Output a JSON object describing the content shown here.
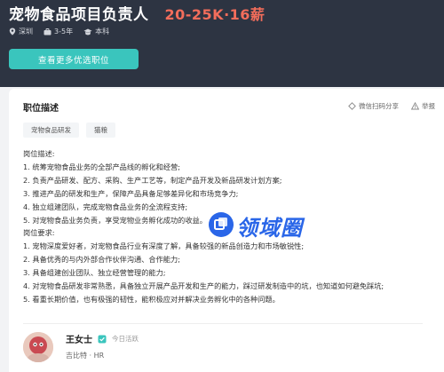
{
  "header": {
    "job_title": "宠物食品项目负责人",
    "salary": "20-25K·16薪",
    "meta": {
      "location": "深圳",
      "experience": "3-5年",
      "education": "本科"
    },
    "more_button": "查看更多优选职位"
  },
  "card": {
    "section_title": "职位描述",
    "wechat_share": "微信扫码分享",
    "report": "举报",
    "tags": [
      "宠物食品研发",
      "猫粮"
    ],
    "description_lines": [
      "岗位描述:",
      "1. 统筹宠物食品业务的全部产品线的孵化和经营;",
      "2. 负责产品研发、配方、采购、生产工艺等，制定产品开发及新品研发计划方案;",
      "3. 推进产品的研发和生产，保障产品具备足够差异化和市场竞争力;",
      "4. 独立组建团队，完成宠物食品业务的全流程支持;",
      "5. 对宠物食品业务负责，享受宠物业务孵化成功的收益。",
      "岗位要求:",
      "1. 宠物深度爱好者，对宠物食品行业有深度了解，具备较强的新品创造力和市场敏锐性;",
      "2. 具备优秀的与内外部合作伙伴沟通、合作能力;",
      "3. 具备组建创业团队、独立经营管理的能力;",
      "4. 对宠物食品研发非常熟悉，具备独立开展产品开发和生产的能力，踩过研发制造中的坑，也知道如何避免踩坑;",
      "5. 看重长期价值，也有极强的韧性，能积极应对并解决业务孵化中的各种问题。"
    ],
    "watermark": "领域圈"
  },
  "recruiter": {
    "name": "王女士",
    "active_status": "今日活跃",
    "company_role": "吉比特 · HR"
  },
  "colors": {
    "header_bg": "#2d3442",
    "salary": "#f26d5b",
    "button_bg": "#3ac5bd",
    "watermark": "#2a66e8"
  }
}
